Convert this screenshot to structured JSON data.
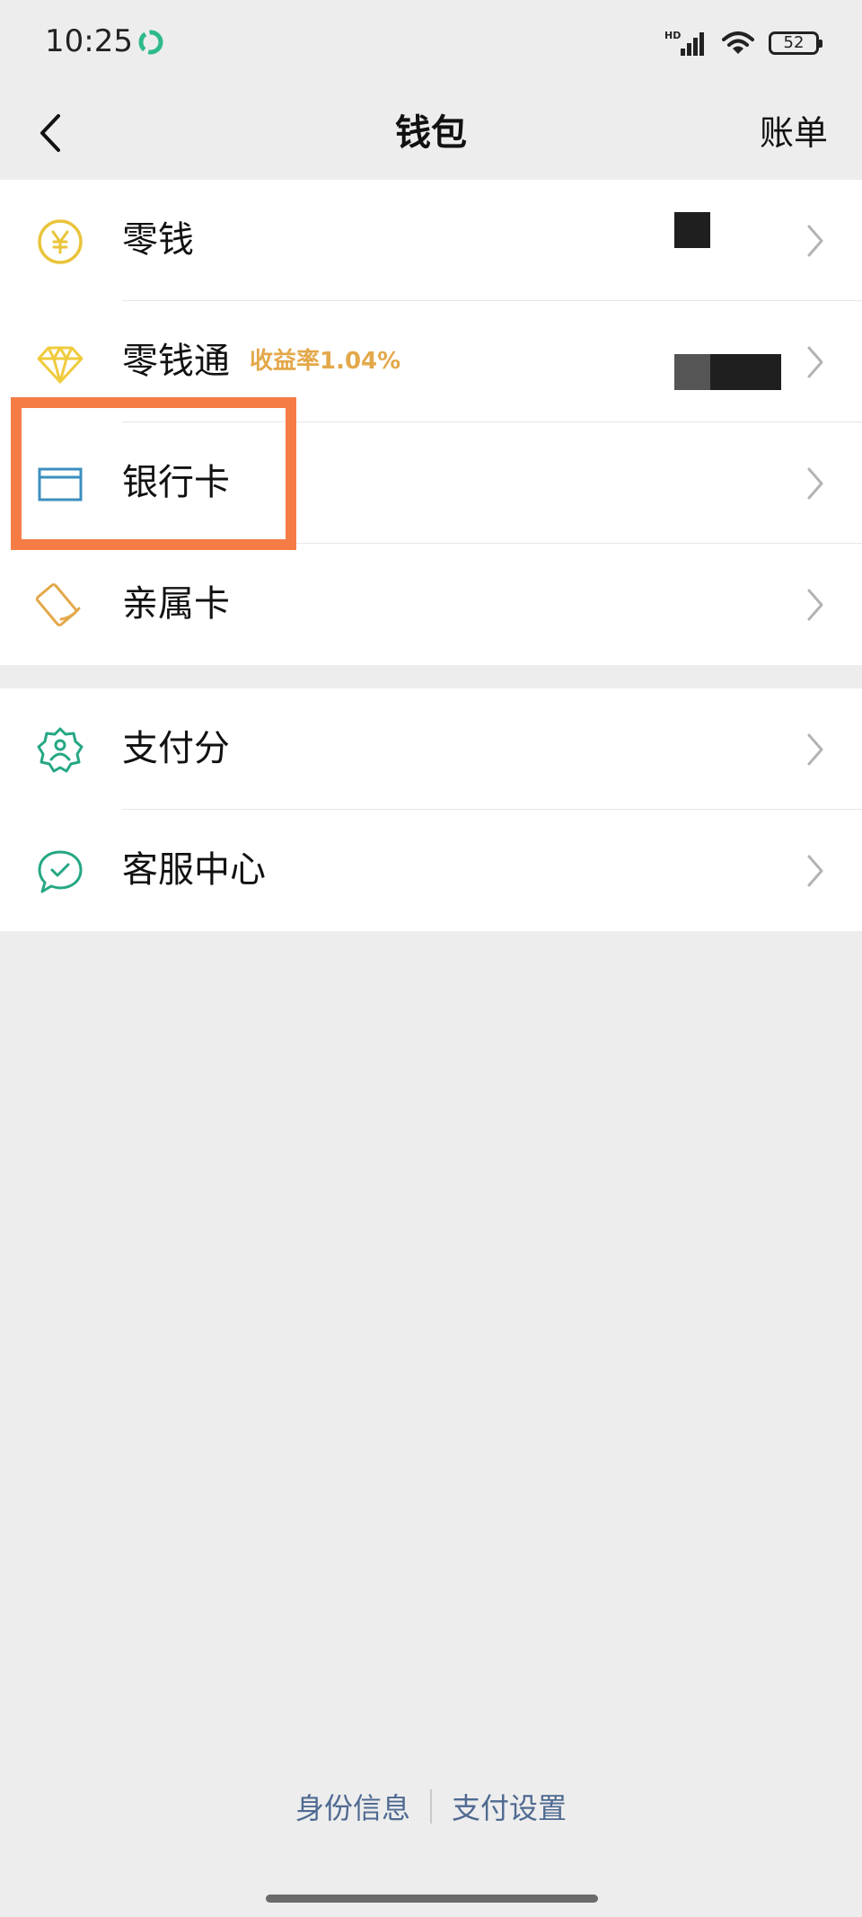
{
  "status_bar": {
    "time": "10:25",
    "network": "HD",
    "battery": "52"
  },
  "nav": {
    "back_icon": "chevron-left-icon",
    "title": "钱包",
    "bills_label": "账单"
  },
  "wallet_items": [
    {
      "label": "零钱",
      "icon": "yuan-coin-icon",
      "color": "#e9c43a"
    },
    {
      "label": "零钱通",
      "sublabel": "收益率1.04%",
      "icon": "diamond-icon",
      "color": "#f0cb3c"
    },
    {
      "label": "银行卡",
      "icon": "bank-card-icon",
      "color": "#3b8fbf"
    },
    {
      "label": "亲属卡",
      "icon": "family-card-icon",
      "color": "#e3a84a"
    }
  ],
  "service_items": [
    {
      "label": "支付分",
      "icon": "pay-score-icon",
      "color": "#25a784"
    },
    {
      "label": "客服中心",
      "icon": "customer-service-icon",
      "color": "#25a784"
    }
  ],
  "footer": {
    "identity_label": "身份信息",
    "settings_label": "支付设置",
    "link_color": "#4f6a91"
  },
  "highlight_color": "#f57c45"
}
